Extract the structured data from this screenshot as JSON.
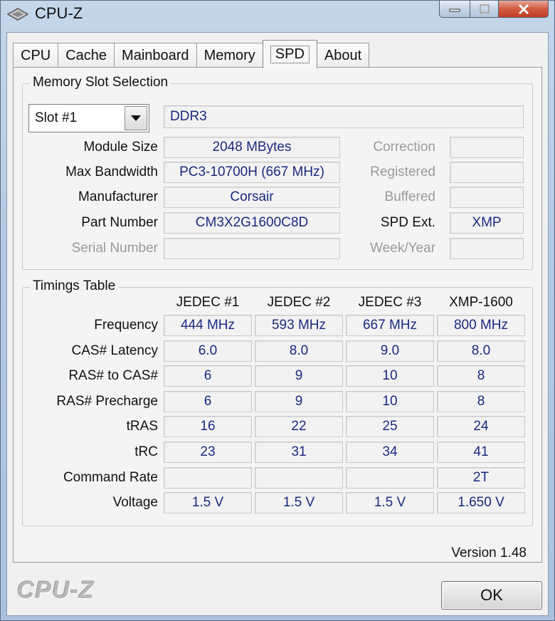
{
  "window": {
    "title": "CPU-Z"
  },
  "tabs": [
    "CPU",
    "Cache",
    "Mainboard",
    "Memory",
    "SPD",
    "About"
  ],
  "active_tab": "SPD",
  "slot_group": {
    "title": "Memory Slot Selection",
    "slot_selected": "Slot #1",
    "memory_type": "DDR3",
    "fields": {
      "module_size": {
        "label": "Module Size",
        "value": "2048 MBytes"
      },
      "max_bandwidth": {
        "label": "Max Bandwidth",
        "value": "PC3-10700H (667 MHz)"
      },
      "manufacturer": {
        "label": "Manufacturer",
        "value": "Corsair"
      },
      "part_number": {
        "label": "Part Number",
        "value": "CM3X2G1600C8D"
      },
      "serial_number": {
        "label": "Serial Number",
        "value": ""
      }
    },
    "right_fields": {
      "correction": {
        "label": "Correction",
        "value": ""
      },
      "registered": {
        "label": "Registered",
        "value": ""
      },
      "buffered": {
        "label": "Buffered",
        "value": ""
      },
      "spd_ext": {
        "label": "SPD Ext.",
        "value": "XMP"
      },
      "week_year": {
        "label": "Week/Year",
        "value": ""
      }
    }
  },
  "timings_group": {
    "title": "Timings Table",
    "columns": [
      "JEDEC #1",
      "JEDEC #2",
      "JEDEC #3",
      "XMP-1600"
    ],
    "rows": [
      {
        "label": "Frequency",
        "values": [
          "444 MHz",
          "593 MHz",
          "667 MHz",
          "800 MHz"
        ]
      },
      {
        "label": "CAS# Latency",
        "values": [
          "6.0",
          "8.0",
          "9.0",
          "8.0"
        ]
      },
      {
        "label": "RAS# to CAS#",
        "values": [
          "6",
          "9",
          "10",
          "8"
        ]
      },
      {
        "label": "RAS# Precharge",
        "values": [
          "6",
          "9",
          "10",
          "8"
        ]
      },
      {
        "label": "tRAS",
        "values": [
          "16",
          "22",
          "25",
          "24"
        ]
      },
      {
        "label": "tRC",
        "values": [
          "23",
          "31",
          "34",
          "41"
        ]
      },
      {
        "label": "Command Rate",
        "values": [
          "",
          "",
          "",
          "2T"
        ]
      },
      {
        "label": "Voltage",
        "values": [
          "1.5 V",
          "1.5 V",
          "1.5 V",
          "1.650 V"
        ]
      }
    ]
  },
  "footer": {
    "version": "Version 1.48",
    "brand": "CPU-Z",
    "ok_label": "OK"
  },
  "colors": {
    "value_text": "#1a2a80",
    "dim_label": "#9a9a9a"
  }
}
